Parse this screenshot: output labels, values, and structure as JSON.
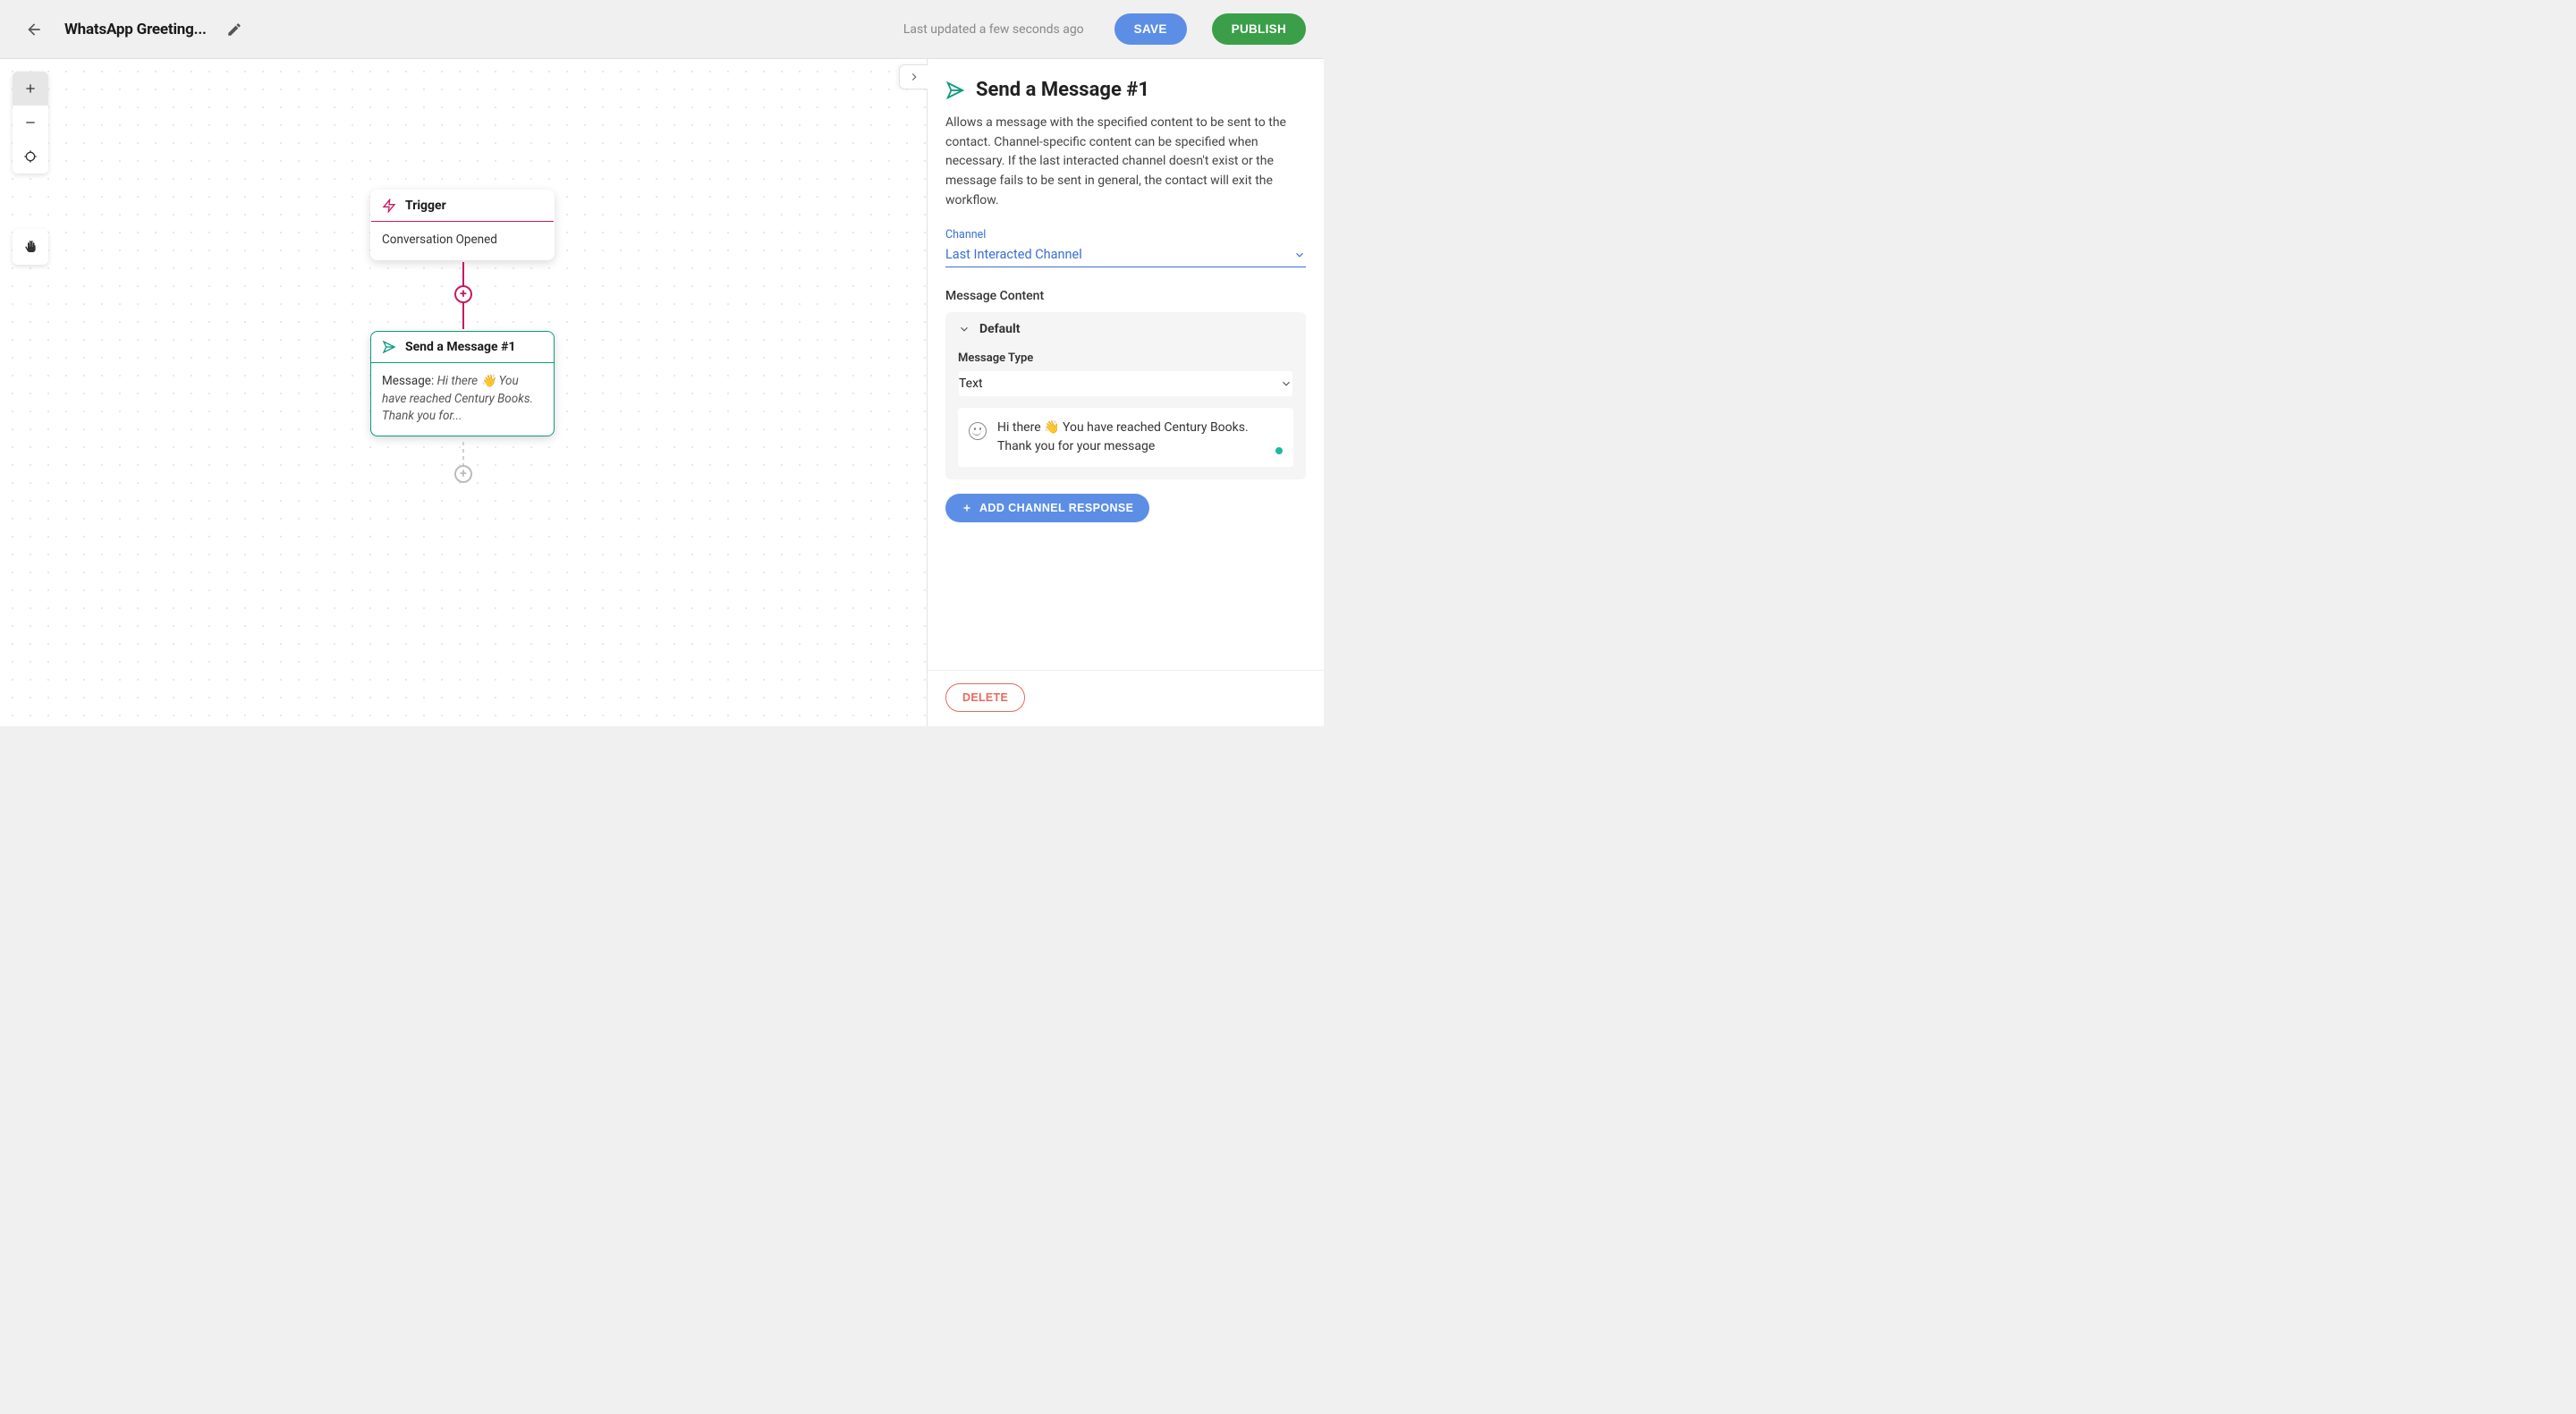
{
  "header": {
    "title": "WhatsApp Greeting...",
    "updated": "Last updated a few seconds ago",
    "save_label": "SAVE",
    "publish_label": "PUBLISH"
  },
  "nodes": {
    "trigger": {
      "title": "Trigger",
      "body": "Conversation Opened"
    },
    "action": {
      "title": "Send a Message #1",
      "msg_prefix": "Message: ",
      "msg_preview": "Hi there 👋 You have reached Century Books. Thank you for..."
    }
  },
  "panel": {
    "title": "Send a Message #1",
    "description": "Allows a message with the specified content to be sent to the contact. Channel-specific content can be specified when necessary. If the last interacted channel doesn't exist or the message fails to be sent in general, the contact will exit the workflow.",
    "channel_label": "Channel",
    "channel_value": "Last Interacted Channel",
    "content_label": "Message Content",
    "default_label": "Default",
    "type_label": "Message Type",
    "type_value": "Text",
    "message_text": "Hi there 👋 You have reached Century Books. Thank you for your message",
    "add_response_label": "ADD CHANNEL RESPONSE",
    "delete_label": "DELETE"
  }
}
